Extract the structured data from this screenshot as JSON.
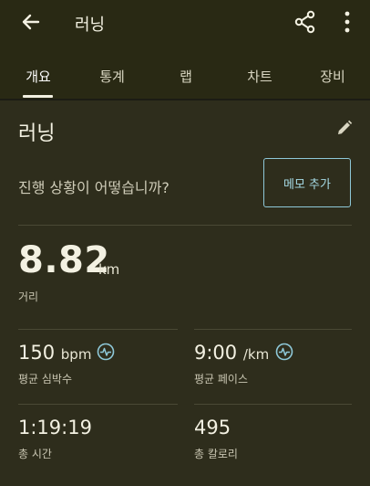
{
  "header": {
    "title": "러닝",
    "back_icon": "back-arrow-icon",
    "share_icon": "share-icon",
    "more_icon": "more-vert-icon"
  },
  "tabs": [
    {
      "label": "개요",
      "active": true
    },
    {
      "label": "통계",
      "active": false
    },
    {
      "label": "랩",
      "active": false
    },
    {
      "label": "차트",
      "active": false
    },
    {
      "label": "장비",
      "active": false
    }
  ],
  "summary": {
    "title": "러닝",
    "prompt": "진행 상황이 어떻습니까?",
    "memo_button": "메모 추가",
    "distance": {
      "value": "8.82",
      "unit": "km",
      "label": "거리"
    },
    "heart_rate": {
      "value": "150",
      "unit": "bpm",
      "label": "평균 심박수"
    },
    "pace": {
      "value": "9:00",
      "unit": "/km",
      "label": "평균 페이스"
    },
    "total_time": {
      "value": "1:19:19",
      "label": "총 시간"
    },
    "calories": {
      "value": "495",
      "label": "총 칼로리"
    }
  },
  "colors": {
    "accent": "#8ec8d8",
    "background": "#1c1c14",
    "card": "#2e2d1c"
  }
}
